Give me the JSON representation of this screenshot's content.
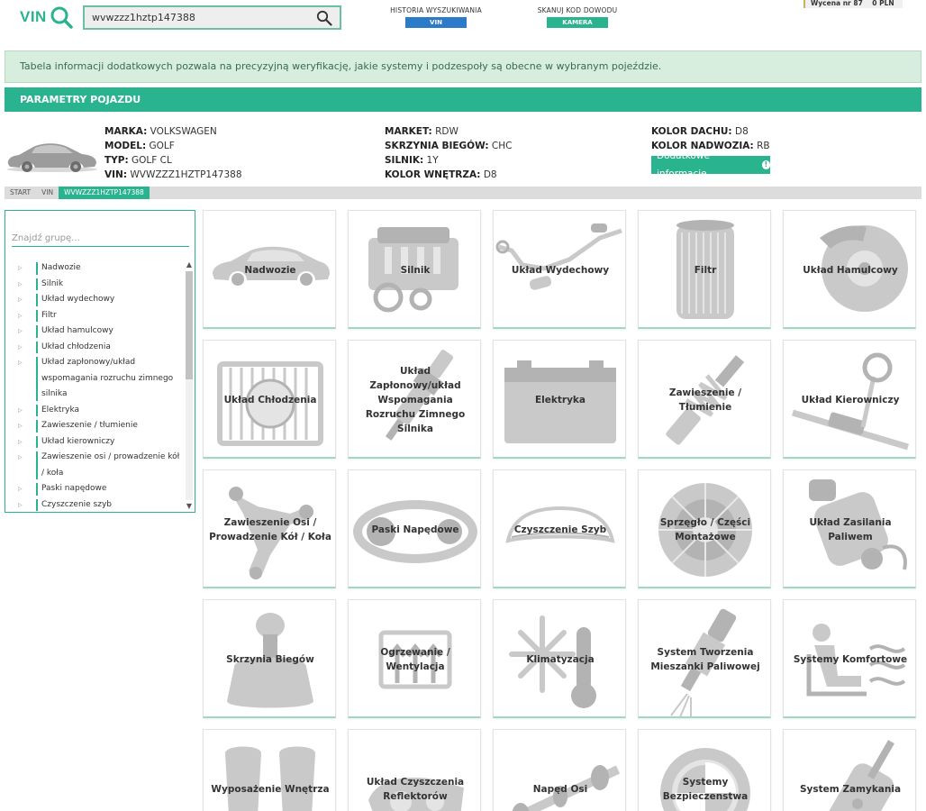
{
  "header": {
    "logo_text": "VIN",
    "search_value": "wvwzzz1hztp147388",
    "history_label": "HISTORIA WYSZUKIWANIA",
    "history_button": "VIN",
    "scan_label": "SKANUJ KOD DOWODU",
    "scan_button": "KAMERA",
    "quote_label": "Wycena nr 87",
    "quote_value": "0 PLN"
  },
  "info_banner": "Tabela informacji dodatkowych pozwala na precyzyjną weryfikację, jakie systemy i podzespoły są obecne w wybranym pojeździe.",
  "params": {
    "title": "PARAMETRY POJAZDU",
    "col1": [
      {
        "key": "MARKA:",
        "value": "VOLKSWAGEN"
      },
      {
        "key": "MODEL:",
        "value": "GOLF"
      },
      {
        "key": "TYP:",
        "value": "GOLF CL"
      },
      {
        "key": "VIN:",
        "value": "WVWZZZ1HZTP147388"
      }
    ],
    "col2": [
      {
        "key": "MARKET:",
        "value": "RDW"
      },
      {
        "key": "SKRZYNIA BIEGÓW:",
        "value": "CHC"
      },
      {
        "key": "SILNIK:",
        "value": "1Y"
      },
      {
        "key": "KOLOR WNĘTRZA:",
        "value": "D8"
      }
    ],
    "col3": [
      {
        "key": "KOLOR DACHU:",
        "value": "D8"
      },
      {
        "key": "KOLOR NADWOZIA:",
        "value": "RB"
      }
    ],
    "extra_button": "Dodatkowe informacje"
  },
  "breadcrumb": [
    "START",
    "VIN",
    "WVWZZZ1HZTP147388"
  ],
  "sidebar": {
    "search_placeholder": "Znajdź grupę...",
    "items": [
      "Nadwozie",
      "Silnik",
      "Układ wydechowy",
      "Filtr",
      "Układ hamulcowy",
      "Układ chłodzenia",
      "Układ zapłonowy/układ wspomagania rozruchu zimnego silnika",
      "Elektryka",
      "Zawieszenie / tłumienie",
      "Układ kierowniczy",
      "Zawieszenie osi / prowadzenie kół / koła",
      "Paski napędowe",
      "Czyszczenie szyb"
    ]
  },
  "tiles": [
    {
      "label": "Nadwozie",
      "icon": "car-body-icon"
    },
    {
      "label": "Silnik",
      "icon": "engine-icon"
    },
    {
      "label": "Układ Wydechowy",
      "icon": "exhaust-icon"
    },
    {
      "label": "Filtr",
      "icon": "filter-icon"
    },
    {
      "label": "Układ Hamulcowy",
      "icon": "brake-icon"
    },
    {
      "label": "Układ Chłodzenia",
      "icon": "radiator-icon"
    },
    {
      "label": "Układ Zapłonowy/układ Wspomagania Rozruchu Zimnego Silnika",
      "icon": "spark-plug-icon"
    },
    {
      "label": "Elektryka",
      "icon": "battery-icon"
    },
    {
      "label": "Zawieszenie / Tłumienie",
      "icon": "shock-absorber-icon"
    },
    {
      "label": "Układ Kierowniczy",
      "icon": "steering-rack-icon"
    },
    {
      "label": "Zawieszenie Osi / Prowadzenie Kół / Koła",
      "icon": "control-arm-icon"
    },
    {
      "label": "Paski Napędowe",
      "icon": "belt-icon"
    },
    {
      "label": "Czyszczenie Szyb",
      "icon": "windshield-icon"
    },
    {
      "label": "Sprzęgło / Części Montażowe",
      "icon": "clutch-icon"
    },
    {
      "label": "Układ Zasilania Paliwem",
      "icon": "fuel-pump-icon"
    },
    {
      "label": "Skrzynia Biegów",
      "icon": "gear-knob-icon"
    },
    {
      "label": "Ogrzewanie / Wentylacja",
      "icon": "heating-icon"
    },
    {
      "label": "Klimatyzacja",
      "icon": "snowflake-thermometer-icon"
    },
    {
      "label": "System Tworzenia Mieszanki Paliwowej",
      "icon": "injector-icon"
    },
    {
      "label": "Systemy Komfortowe",
      "icon": "seat-comfort-icon"
    },
    {
      "label": "Wyposażenie Wnętrza",
      "icon": "seats-icon"
    },
    {
      "label": "Układ Czyszczenia Reflektorów",
      "icon": "headlight-washer-icon"
    },
    {
      "label": "Napęd Osi",
      "icon": "driveshaft-icon"
    },
    {
      "label": "Systemy Bezpieczenstwa",
      "icon": "safety-icon"
    },
    {
      "label": "System Zamykania",
      "icon": "key-lock-icon"
    }
  ]
}
